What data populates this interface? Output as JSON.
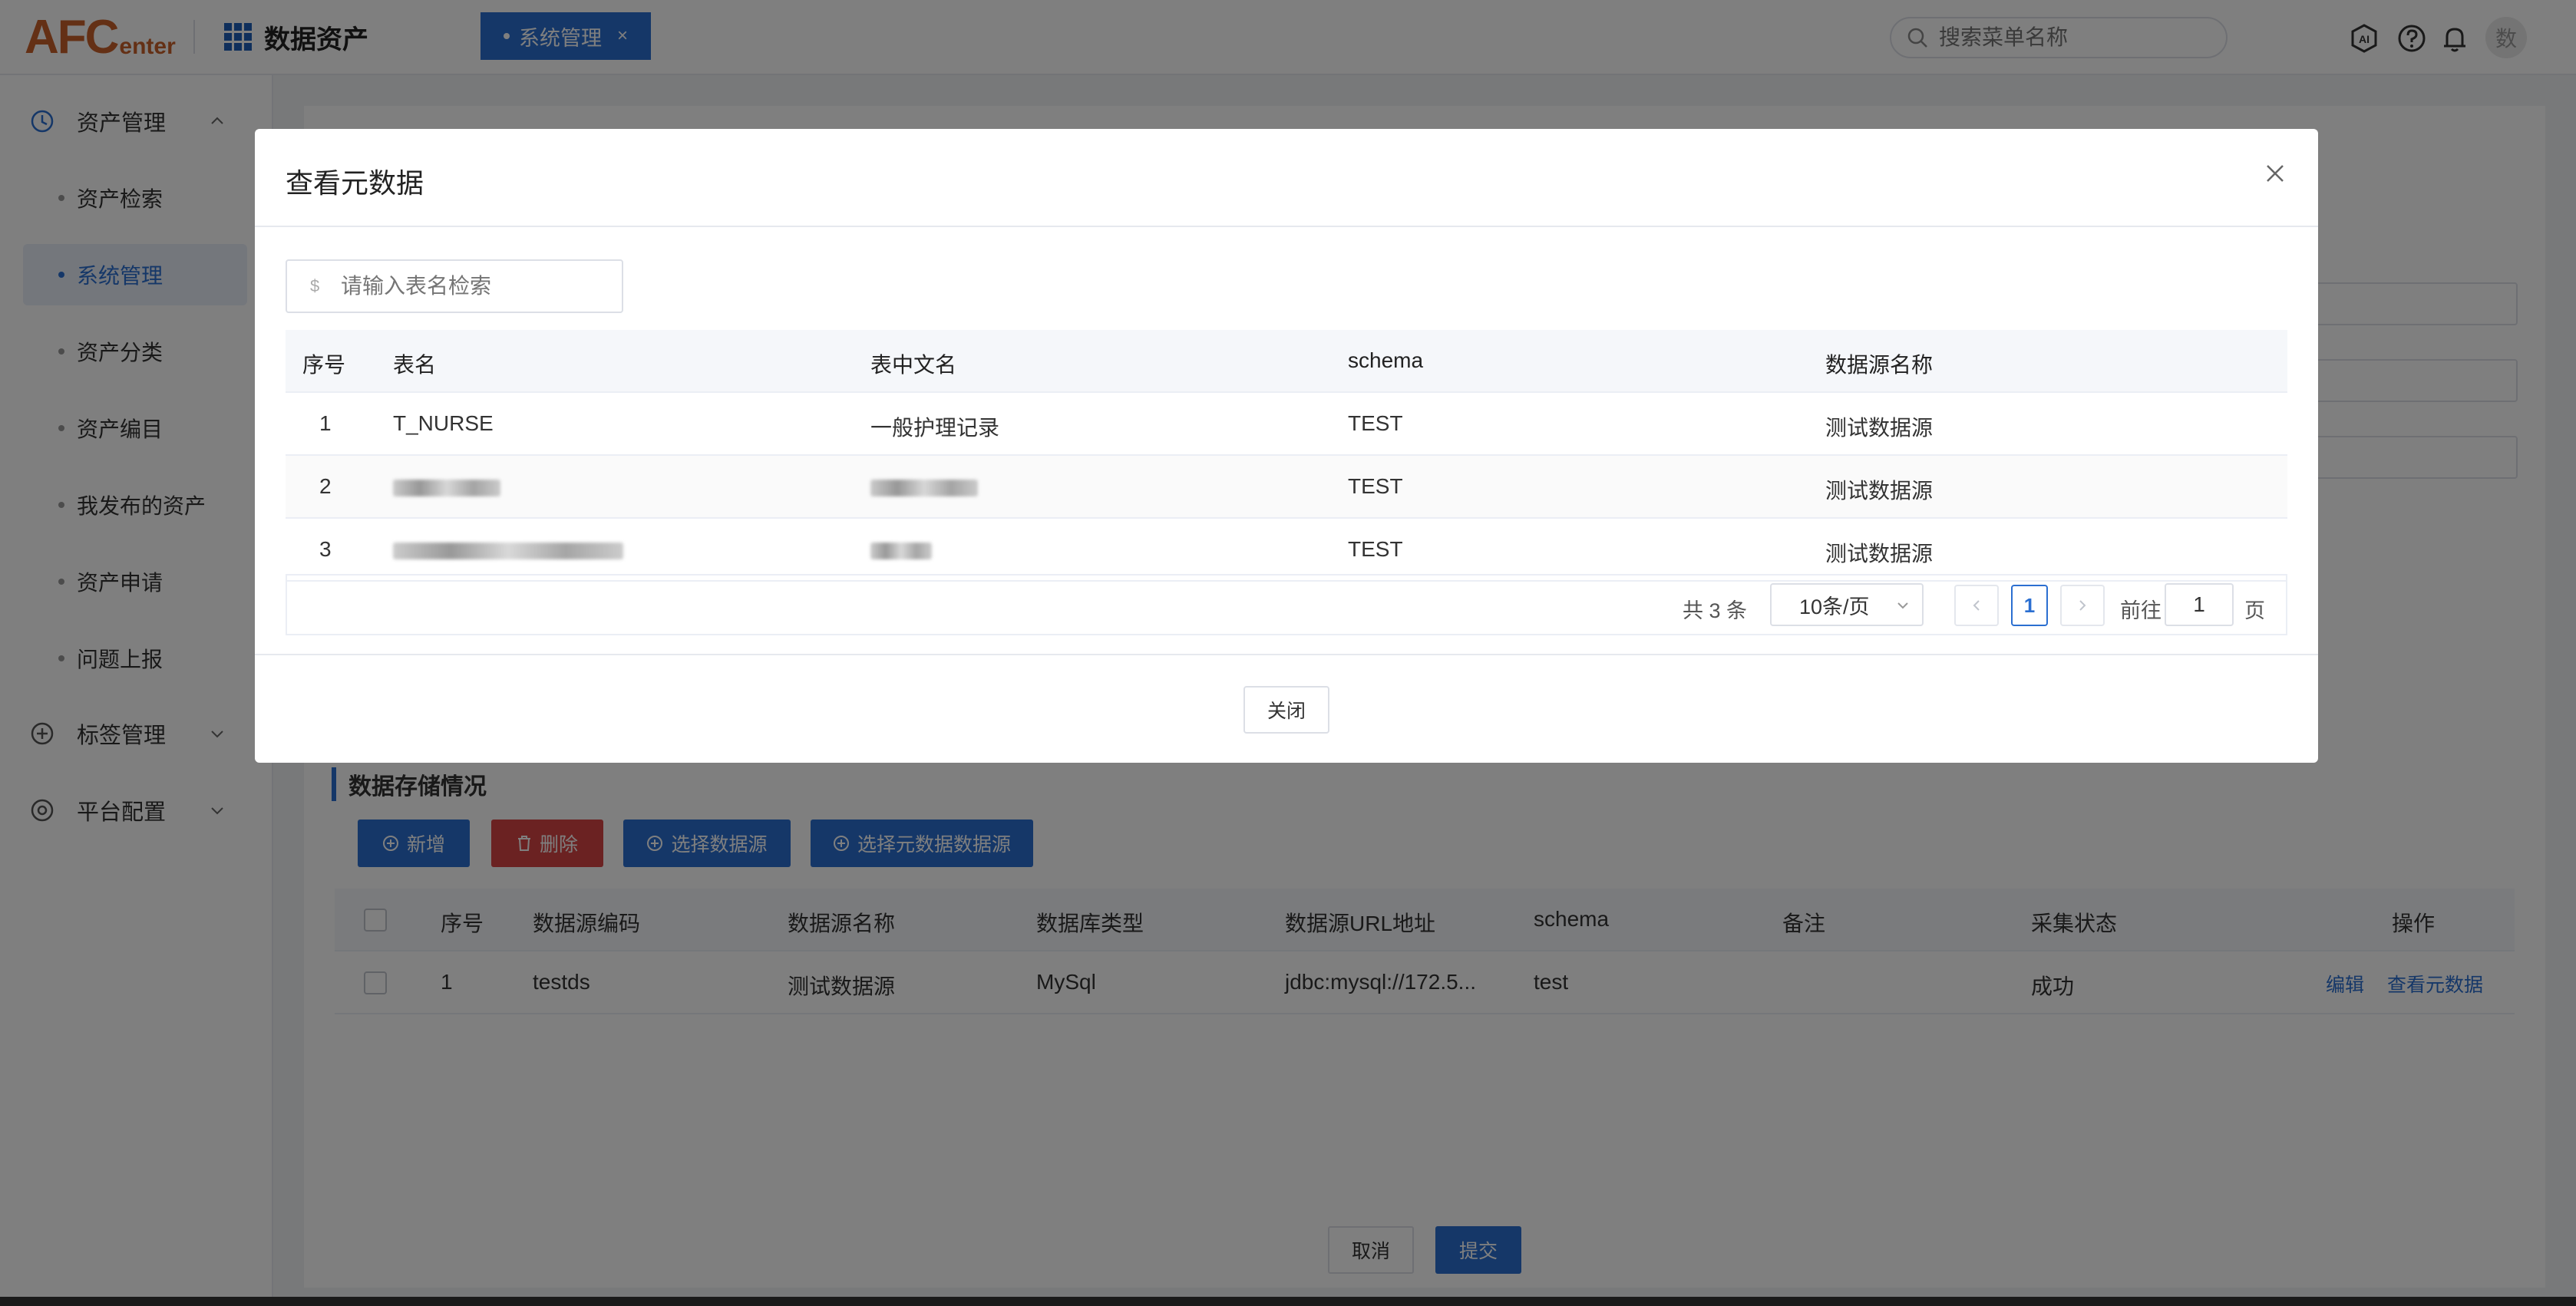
{
  "header": {
    "logo_big": "AFC",
    "logo_small": "enter",
    "app_title": "数据资产",
    "active_tab": "系统管理",
    "tab_close": "×",
    "search_placeholder": "搜索菜单名称",
    "avatar_text": "数"
  },
  "sidebar": {
    "groups": [
      {
        "label": "资产管理"
      },
      {
        "label": "标签管理"
      },
      {
        "label": "平台配置"
      }
    ],
    "items": [
      {
        "label": "资产检索"
      },
      {
        "label": "系统管理"
      },
      {
        "label": "资产分类"
      },
      {
        "label": "资产编目"
      },
      {
        "label": "我发布的资产"
      },
      {
        "label": "资产申请"
      },
      {
        "label": "问题上报"
      }
    ],
    "active_item": "系统管理"
  },
  "background": {
    "section_title": "数据存储情况",
    "buttons": {
      "add": "新增",
      "delete": "删除",
      "select_source": "选择数据源",
      "select_meta_source": "选择元数据数据源"
    },
    "table": {
      "headers": [
        "序号",
        "数据源编码",
        "数据源名称",
        "数据库类型",
        "数据源URL地址",
        "schema",
        "备注",
        "采集状态",
        "操作"
      ],
      "rows": [
        {
          "index": "1",
          "code": "testds",
          "name": "测试数据源",
          "db_type": "MySql",
          "url": "jdbc:mysql://172.5...",
          "schema": "test",
          "remark": "",
          "status": "成功",
          "edit": "编辑",
          "view_meta": "查看元数据"
        }
      ]
    },
    "footer": {
      "cancel": "取消",
      "submit": "提交"
    }
  },
  "dialog": {
    "title": "查看元数据",
    "search_prefix": "$",
    "search_placeholder": "请输入表名检索",
    "headers": [
      "序号",
      "表名",
      "表中文名",
      "schema",
      "数据源名称"
    ],
    "rows": [
      {
        "index": "1",
        "table_name": "T_NURSE",
        "cn_name": "一般护理记录",
        "schema": "TEST",
        "source": "测试数据源"
      },
      {
        "index": "2",
        "table_name": "",
        "cn_name": "",
        "schema": "TEST",
        "source": "测试数据源"
      },
      {
        "index": "3",
        "table_name": "",
        "cn_name": "",
        "schema": "TEST",
        "source": "测试数据源"
      }
    ],
    "pagination": {
      "total": "共 3 条",
      "page_size": "10条/页",
      "current_page": "1",
      "goto_label": "前往",
      "goto_value": "1",
      "page_unit": "页"
    },
    "close_button": "关闭"
  },
  "colors": {
    "primary": "#2b6fd1",
    "danger": "#d64545",
    "logo": "#c8612a"
  },
  "icons": [
    "apps-grid-icon",
    "search-icon",
    "ai-icon",
    "help-icon",
    "bell-icon",
    "clock-icon",
    "chevron-up-icon",
    "chevron-down-icon",
    "plus-circle-icon",
    "target-icon",
    "close-icon",
    "trash-icon",
    "chevron-left-icon",
    "chevron-right-icon",
    "caret-down-icon"
  ]
}
